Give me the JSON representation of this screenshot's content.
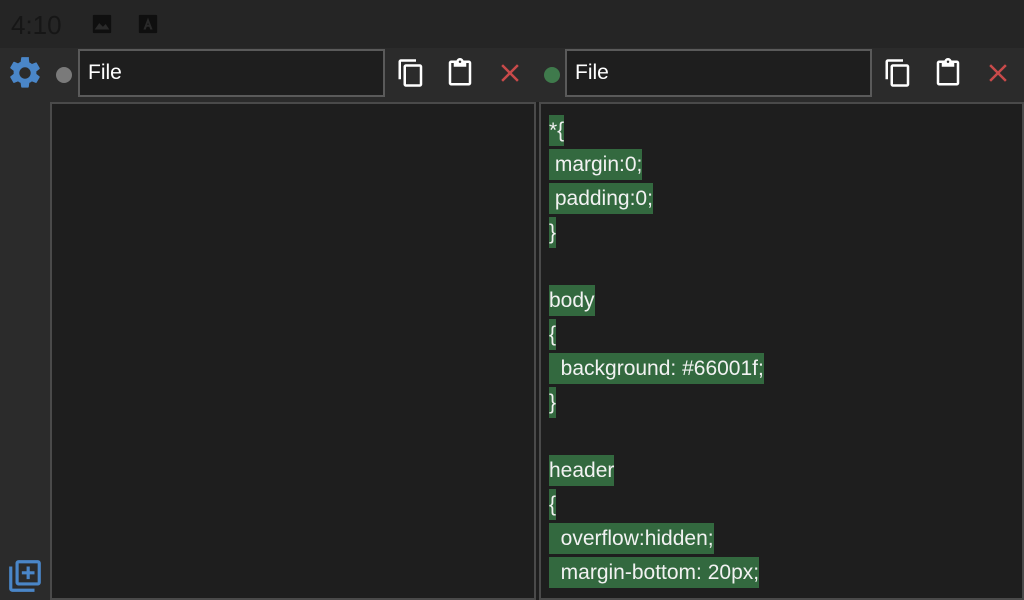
{
  "status_bar": {
    "time": "4:10",
    "icons": [
      "image-icon",
      "app-icon"
    ]
  },
  "sidebar": {
    "top_icon": "gear-icon",
    "bottom_icon": "add-file-icon"
  },
  "left_editor": {
    "file_value": "File",
    "status_color": "#7a7a7a",
    "code_lines": []
  },
  "right_editor": {
    "file_value": "File",
    "status_color": "#3f7a4c",
    "code_lines": [
      "*{",
      " margin:0;",
      " padding:0;",
      "}",
      "",
      "body",
      "{",
      "  background: #66001f;",
      "}",
      "",
      "header",
      "{",
      "  overflow:hidden;",
      "  margin-bottom: 20px;"
    ]
  },
  "colors": {
    "accent_blue": "#4a86c8",
    "close_red": "#c94a4a",
    "highlight_green": "#33693f"
  }
}
